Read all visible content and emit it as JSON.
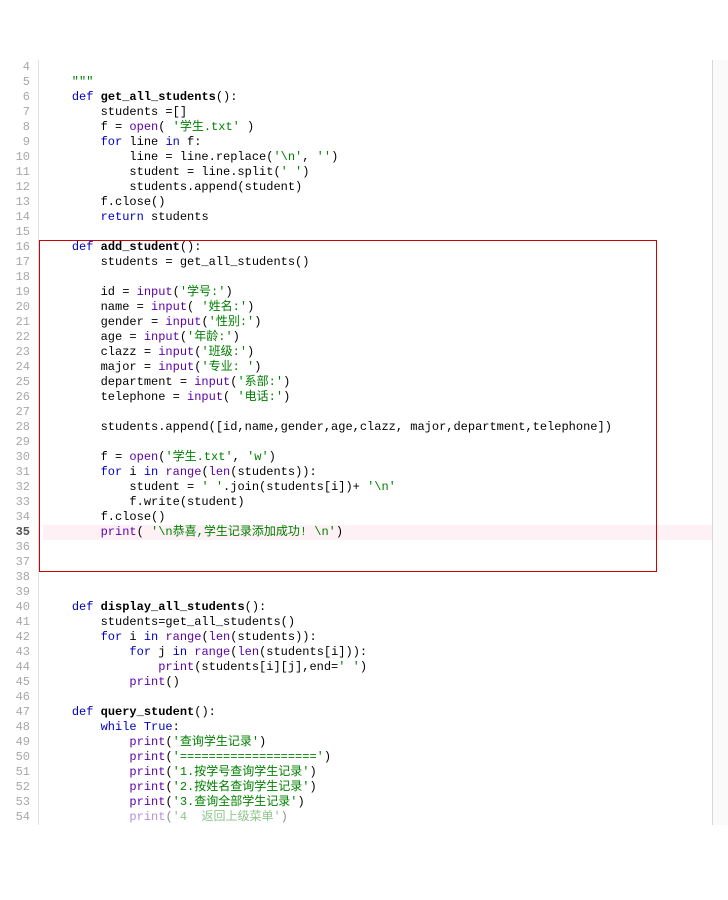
{
  "lines": [
    {
      "n": "4",
      "tokens": []
    },
    {
      "n": "5",
      "tokens": [
        {
          "c": "str",
          "t": "    \"\"\""
        }
      ]
    },
    {
      "n": "6",
      "tokens": [
        {
          "c": "txt",
          "t": "    "
        },
        {
          "c": "kw",
          "t": "def "
        },
        {
          "c": "fn",
          "t": "get_all_students"
        },
        {
          "c": "txt",
          "t": "():"
        }
      ]
    },
    {
      "n": "7",
      "tokens": [
        {
          "c": "txt",
          "t": "        students =[]"
        }
      ]
    },
    {
      "n": "8",
      "tokens": [
        {
          "c": "txt",
          "t": "        f = "
        },
        {
          "c": "bi",
          "t": "open"
        },
        {
          "c": "txt",
          "t": "( "
        },
        {
          "c": "str",
          "t": "'学生.txt'"
        },
        {
          "c": "txt",
          "t": " )"
        }
      ]
    },
    {
      "n": "9",
      "tokens": [
        {
          "c": "txt",
          "t": "        "
        },
        {
          "c": "kw",
          "t": "for"
        },
        {
          "c": "txt",
          "t": " line "
        },
        {
          "c": "kw",
          "t": "in"
        },
        {
          "c": "txt",
          "t": " f:"
        }
      ]
    },
    {
      "n": "10",
      "tokens": [
        {
          "c": "txt",
          "t": "            line = line.replace("
        },
        {
          "c": "str",
          "t": "'\\n'"
        },
        {
          "c": "txt",
          "t": ", "
        },
        {
          "c": "str",
          "t": "''"
        },
        {
          "c": "txt",
          "t": ")"
        }
      ]
    },
    {
      "n": "11",
      "tokens": [
        {
          "c": "txt",
          "t": "            student = line.split("
        },
        {
          "c": "str",
          "t": "' '"
        },
        {
          "c": "txt",
          "t": ")"
        }
      ]
    },
    {
      "n": "12",
      "tokens": [
        {
          "c": "txt",
          "t": "            students.append(student)"
        }
      ]
    },
    {
      "n": "13",
      "tokens": [
        {
          "c": "txt",
          "t": "        f.close()"
        }
      ]
    },
    {
      "n": "14",
      "tokens": [
        {
          "c": "txt",
          "t": "        "
        },
        {
          "c": "kw",
          "t": "return"
        },
        {
          "c": "txt",
          "t": " students"
        }
      ]
    },
    {
      "n": "15",
      "tokens": []
    },
    {
      "n": "16",
      "tokens": [
        {
          "c": "txt",
          "t": "    "
        },
        {
          "c": "kw",
          "t": "def "
        },
        {
          "c": "fn",
          "t": "add_student"
        },
        {
          "c": "txt",
          "t": "():"
        }
      ]
    },
    {
      "n": "17",
      "tokens": [
        {
          "c": "txt",
          "t": "        students = get_all_students()"
        }
      ]
    },
    {
      "n": "18",
      "tokens": []
    },
    {
      "n": "19",
      "tokens": [
        {
          "c": "txt",
          "t": "        id = "
        },
        {
          "c": "bi",
          "t": "input"
        },
        {
          "c": "txt",
          "t": "("
        },
        {
          "c": "str",
          "t": "'学号:'"
        },
        {
          "c": "txt",
          "t": ")"
        }
      ]
    },
    {
      "n": "20",
      "tokens": [
        {
          "c": "txt",
          "t": "        name = "
        },
        {
          "c": "bi",
          "t": "input"
        },
        {
          "c": "txt",
          "t": "( "
        },
        {
          "c": "str",
          "t": "'姓名:'"
        },
        {
          "c": "txt",
          "t": ")"
        }
      ]
    },
    {
      "n": "21",
      "tokens": [
        {
          "c": "txt",
          "t": "        gender = "
        },
        {
          "c": "bi",
          "t": "input"
        },
        {
          "c": "txt",
          "t": "("
        },
        {
          "c": "str",
          "t": "'性别:'"
        },
        {
          "c": "txt",
          "t": ")"
        }
      ]
    },
    {
      "n": "22",
      "tokens": [
        {
          "c": "txt",
          "t": "        age = "
        },
        {
          "c": "bi",
          "t": "input"
        },
        {
          "c": "txt",
          "t": "("
        },
        {
          "c": "str",
          "t": "'年龄:'"
        },
        {
          "c": "txt",
          "t": ")"
        }
      ]
    },
    {
      "n": "23",
      "tokens": [
        {
          "c": "txt",
          "t": "        clazz = "
        },
        {
          "c": "bi",
          "t": "input"
        },
        {
          "c": "txt",
          "t": "("
        },
        {
          "c": "str",
          "t": "'班级:'"
        },
        {
          "c": "txt",
          "t": ")"
        }
      ]
    },
    {
      "n": "24",
      "tokens": [
        {
          "c": "txt",
          "t": "        major = "
        },
        {
          "c": "bi",
          "t": "input"
        },
        {
          "c": "txt",
          "t": "("
        },
        {
          "c": "str",
          "t": "'专业: '"
        },
        {
          "c": "txt",
          "t": ")"
        }
      ]
    },
    {
      "n": "25",
      "tokens": [
        {
          "c": "txt",
          "t": "        department = "
        },
        {
          "c": "bi",
          "t": "input"
        },
        {
          "c": "txt",
          "t": "("
        },
        {
          "c": "str",
          "t": "'系部:'"
        },
        {
          "c": "txt",
          "t": ")"
        }
      ]
    },
    {
      "n": "26",
      "tokens": [
        {
          "c": "txt",
          "t": "        telephone = "
        },
        {
          "c": "bi",
          "t": "input"
        },
        {
          "c": "txt",
          "t": "( "
        },
        {
          "c": "str",
          "t": "'电话:'"
        },
        {
          "c": "txt",
          "t": ")"
        }
      ]
    },
    {
      "n": "27",
      "tokens": []
    },
    {
      "n": "28",
      "tokens": [
        {
          "c": "txt",
          "t": "        students.append([id,name,gender,age,clazz, major,department,telephone])"
        }
      ]
    },
    {
      "n": "29",
      "tokens": []
    },
    {
      "n": "30",
      "tokens": [
        {
          "c": "txt",
          "t": "        f = "
        },
        {
          "c": "bi",
          "t": "open"
        },
        {
          "c": "txt",
          "t": "("
        },
        {
          "c": "str",
          "t": "'学生.txt'"
        },
        {
          "c": "txt",
          "t": ", "
        },
        {
          "c": "str",
          "t": "'w'"
        },
        {
          "c": "txt",
          "t": ")"
        }
      ]
    },
    {
      "n": "31",
      "tokens": [
        {
          "c": "txt",
          "t": "        "
        },
        {
          "c": "kw",
          "t": "for"
        },
        {
          "c": "txt",
          "t": " i "
        },
        {
          "c": "kw",
          "t": "in"
        },
        {
          "c": "txt",
          "t": " "
        },
        {
          "c": "bi",
          "t": "range"
        },
        {
          "c": "txt",
          "t": "("
        },
        {
          "c": "bi",
          "t": "len"
        },
        {
          "c": "txt",
          "t": "(students)):"
        }
      ]
    },
    {
      "n": "32",
      "tokens": [
        {
          "c": "txt",
          "t": "            student = "
        },
        {
          "c": "str",
          "t": "' '"
        },
        {
          "c": "txt",
          "t": ".join(students[i])+ "
        },
        {
          "c": "str",
          "t": "'\\n'"
        }
      ]
    },
    {
      "n": "33",
      "tokens": [
        {
          "c": "txt",
          "t": "            f.write(student)"
        }
      ]
    },
    {
      "n": "34",
      "tokens": [
        {
          "c": "txt",
          "t": "        f.close()"
        }
      ]
    },
    {
      "n": "35",
      "bold": true,
      "hl": true,
      "tokens": [
        {
          "c": "txt",
          "t": "        "
        },
        {
          "c": "bi",
          "t": "print"
        },
        {
          "c": "txt",
          "t": "( "
        },
        {
          "c": "str",
          "t": "'\\n恭喜,学生记录添加成功! \\n'"
        },
        {
          "c": "txt",
          "t": ")"
        }
      ]
    },
    {
      "n": "36",
      "tokens": []
    },
    {
      "n": "37",
      "tokens": []
    },
    {
      "n": "38",
      "tokens": []
    },
    {
      "n": "39",
      "tokens": []
    },
    {
      "n": "40",
      "tokens": [
        {
          "c": "txt",
          "t": "    "
        },
        {
          "c": "kw",
          "t": "def "
        },
        {
          "c": "fn",
          "t": "display_all_students"
        },
        {
          "c": "txt",
          "t": "():"
        }
      ]
    },
    {
      "n": "41",
      "tokens": [
        {
          "c": "txt",
          "t": "        students=get_all_students()"
        }
      ]
    },
    {
      "n": "42",
      "tokens": [
        {
          "c": "txt",
          "t": "        "
        },
        {
          "c": "kw",
          "t": "for"
        },
        {
          "c": "txt",
          "t": " i "
        },
        {
          "c": "kw",
          "t": "in"
        },
        {
          "c": "txt",
          "t": " "
        },
        {
          "c": "bi",
          "t": "range"
        },
        {
          "c": "txt",
          "t": "("
        },
        {
          "c": "bi",
          "t": "len"
        },
        {
          "c": "txt",
          "t": "(students)):"
        }
      ]
    },
    {
      "n": "43",
      "tokens": [
        {
          "c": "txt",
          "t": "            "
        },
        {
          "c": "kw",
          "t": "for"
        },
        {
          "c": "txt",
          "t": " j "
        },
        {
          "c": "kw",
          "t": "in"
        },
        {
          "c": "txt",
          "t": " "
        },
        {
          "c": "bi",
          "t": "range"
        },
        {
          "c": "txt",
          "t": "("
        },
        {
          "c": "bi",
          "t": "len"
        },
        {
          "c": "txt",
          "t": "(students[i])):"
        }
      ]
    },
    {
      "n": "44",
      "tokens": [
        {
          "c": "txt",
          "t": "                "
        },
        {
          "c": "bi",
          "t": "print"
        },
        {
          "c": "txt",
          "t": "(students[i][j],end="
        },
        {
          "c": "str",
          "t": "' '"
        },
        {
          "c": "txt",
          "t": ")"
        }
      ]
    },
    {
      "n": "45",
      "tokens": [
        {
          "c": "txt",
          "t": "            "
        },
        {
          "c": "bi",
          "t": "print"
        },
        {
          "c": "txt",
          "t": "()"
        }
      ]
    },
    {
      "n": "46",
      "tokens": []
    },
    {
      "n": "47",
      "tokens": [
        {
          "c": "txt",
          "t": "    "
        },
        {
          "c": "kw",
          "t": "def "
        },
        {
          "c": "fn",
          "t": "query_student"
        },
        {
          "c": "txt",
          "t": "():"
        }
      ]
    },
    {
      "n": "48",
      "tokens": [
        {
          "c": "txt",
          "t": "        "
        },
        {
          "c": "kw",
          "t": "while"
        },
        {
          "c": "txt",
          "t": " "
        },
        {
          "c": "kw",
          "t": "True"
        },
        {
          "c": "txt",
          "t": ":"
        }
      ]
    },
    {
      "n": "49",
      "tokens": [
        {
          "c": "txt",
          "t": "            "
        },
        {
          "c": "bi",
          "t": "print"
        },
        {
          "c": "txt",
          "t": "("
        },
        {
          "c": "str",
          "t": "'查询学生记录'"
        },
        {
          "c": "txt",
          "t": ")"
        }
      ]
    },
    {
      "n": "50",
      "tokens": [
        {
          "c": "txt",
          "t": "            "
        },
        {
          "c": "bi",
          "t": "print"
        },
        {
          "c": "txt",
          "t": "("
        },
        {
          "c": "str",
          "t": "'==================='"
        },
        {
          "c": "txt",
          "t": ")"
        }
      ]
    },
    {
      "n": "51",
      "tokens": [
        {
          "c": "txt",
          "t": "            "
        },
        {
          "c": "bi",
          "t": "print"
        },
        {
          "c": "txt",
          "t": "("
        },
        {
          "c": "str",
          "t": "'1.按学号查询学生记录'"
        },
        {
          "c": "txt",
          "t": ")"
        }
      ]
    },
    {
      "n": "52",
      "tokens": [
        {
          "c": "txt",
          "t": "            "
        },
        {
          "c": "bi",
          "t": "print"
        },
        {
          "c": "txt",
          "t": "("
        },
        {
          "c": "str",
          "t": "'2.按姓名查询学生记录'"
        },
        {
          "c": "txt",
          "t": ")"
        }
      ]
    },
    {
      "n": "53",
      "tokens": [
        {
          "c": "txt",
          "t": "            "
        },
        {
          "c": "bi",
          "t": "print"
        },
        {
          "c": "txt",
          "t": "("
        },
        {
          "c": "str",
          "t": "'3.查询全部学生记录'"
        },
        {
          "c": "txt",
          "t": ")"
        }
      ]
    },
    {
      "n": "54",
      "faded": true,
      "tokens": [
        {
          "c": "txt",
          "t": "            "
        },
        {
          "c": "bi",
          "t": "print"
        },
        {
          "c": "txt",
          "t": "("
        },
        {
          "c": "str",
          "t": "'4  返回上级菜单'"
        },
        {
          "c": "txt",
          "t": ")"
        }
      ]
    }
  ],
  "redbox": {
    "startLine": 16,
    "endLine": 37
  }
}
